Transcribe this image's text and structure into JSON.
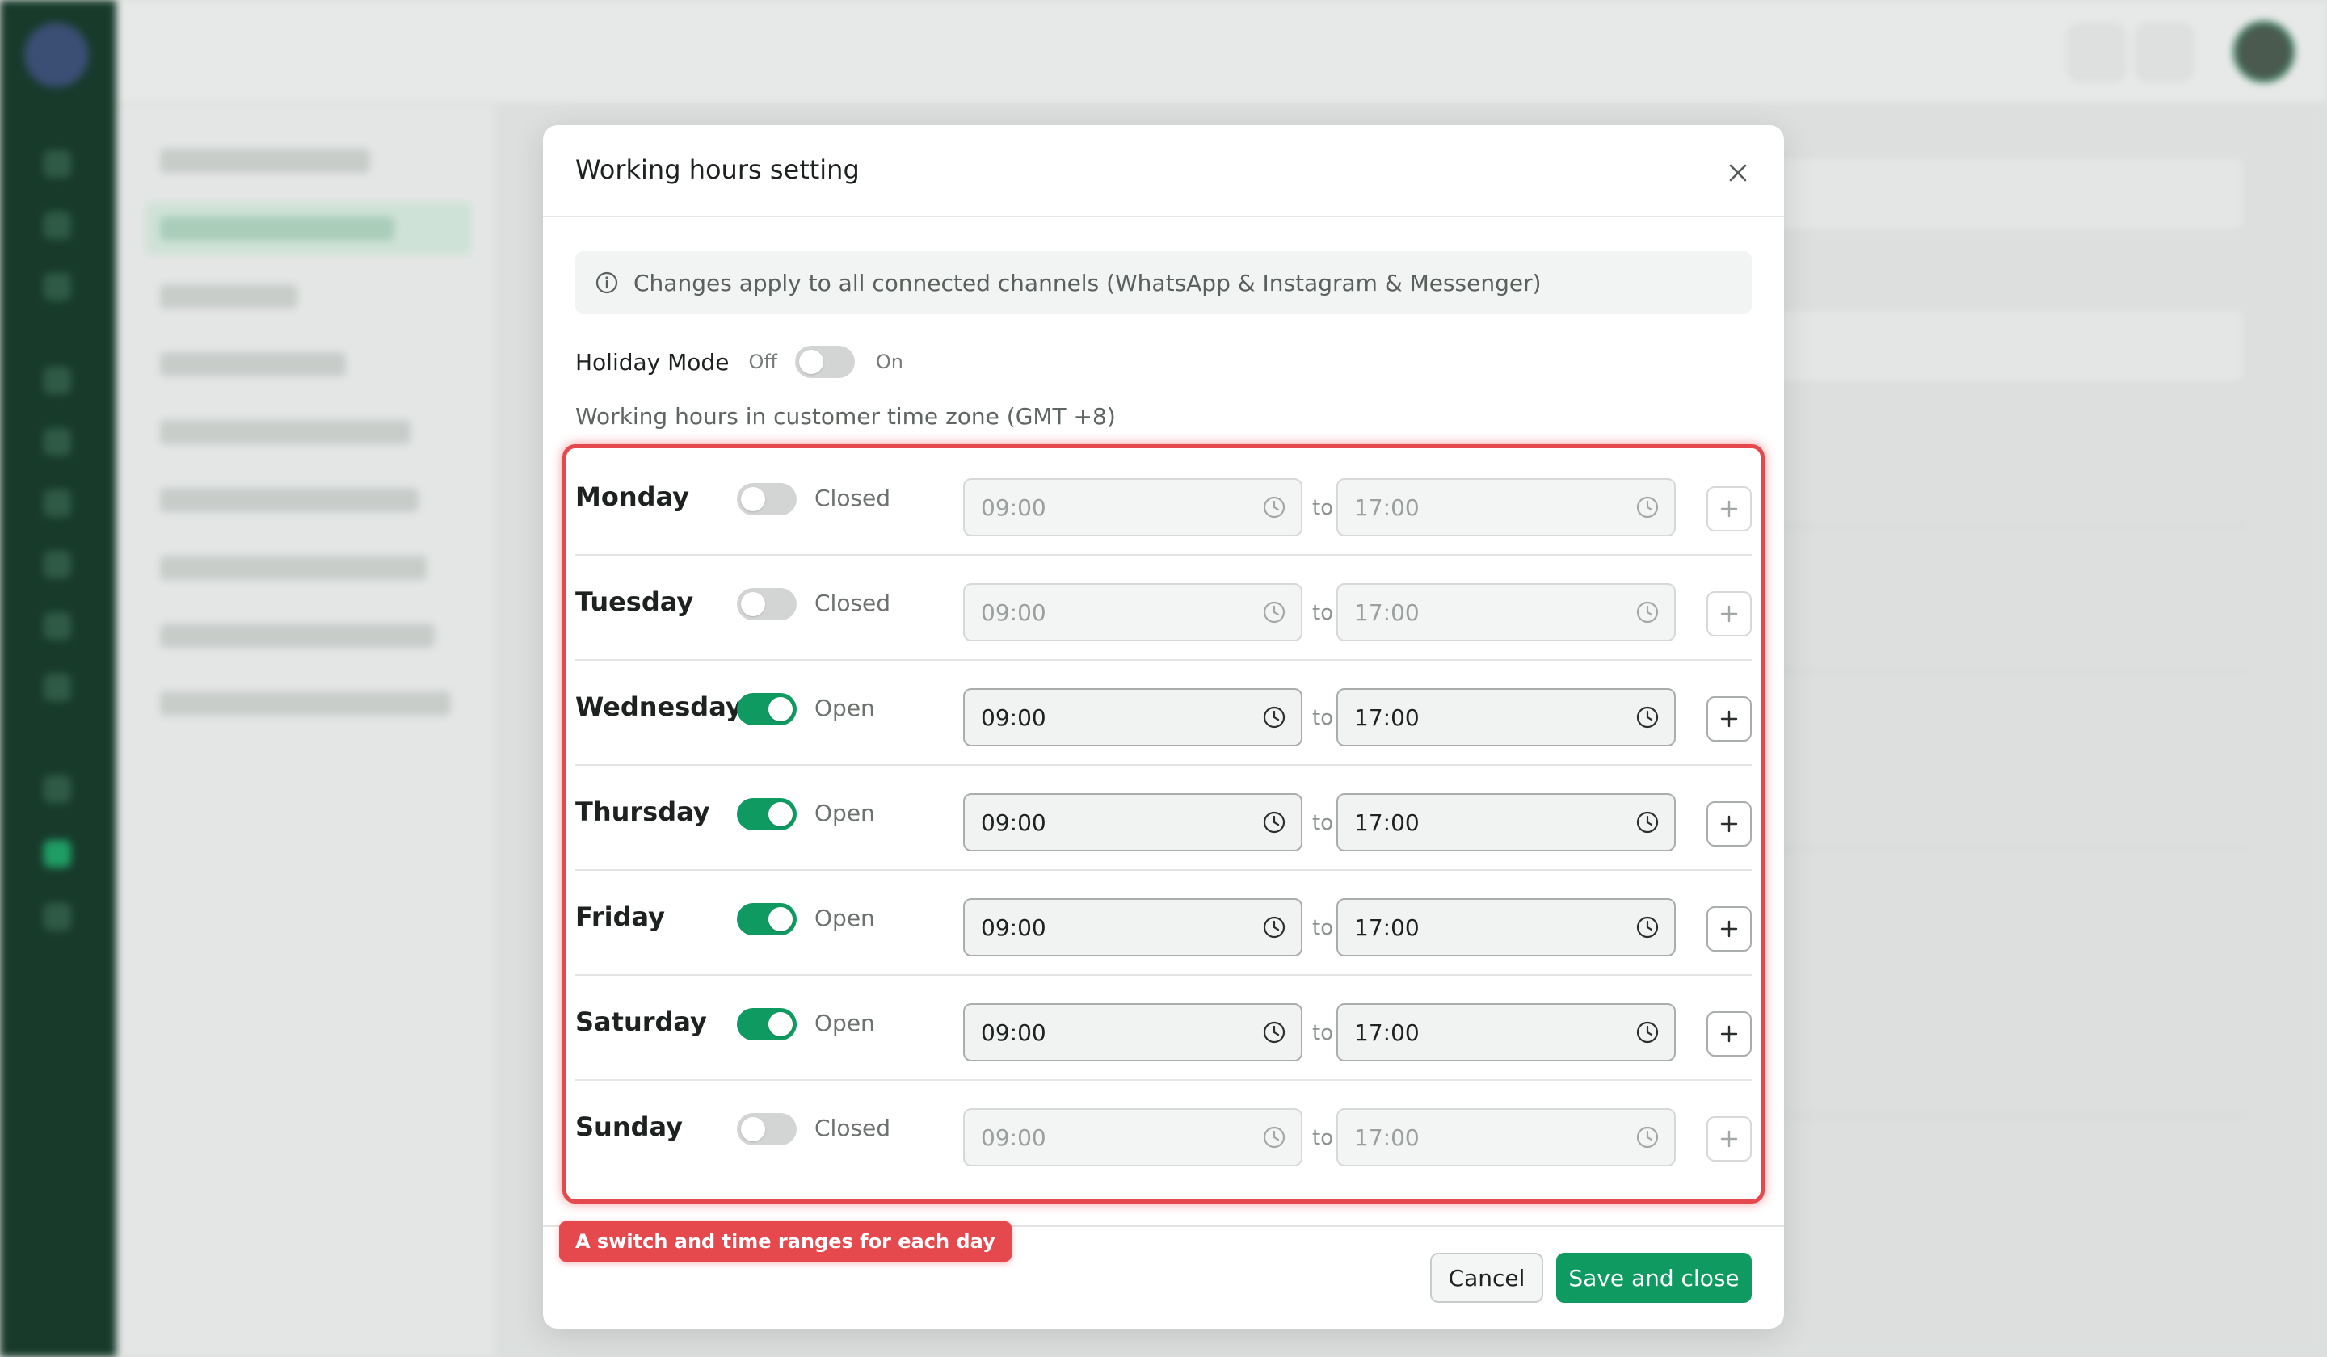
{
  "modal": {
    "title": "Working hours setting",
    "info": "Changes apply to all connected channels (WhatsApp & Instagram & Messenger)",
    "holiday": {
      "label": "Holiday Mode",
      "off_label": "Off",
      "on_label": "On",
      "enabled": false
    },
    "timezone_note": "Working hours in customer time zone (GMT +8)",
    "to_label": "to",
    "days": [
      {
        "name": "Monday",
        "status": "Closed",
        "open": false,
        "start": "09:00",
        "end": "17:00"
      },
      {
        "name": "Tuesday",
        "status": "Closed",
        "open": false,
        "start": "09:00",
        "end": "17:00"
      },
      {
        "name": "Wednesday",
        "status": "Open",
        "open": true,
        "start": "09:00",
        "end": "17:00"
      },
      {
        "name": "Thursday",
        "status": "Open",
        "open": true,
        "start": "09:00",
        "end": "17:00"
      },
      {
        "name": "Friday",
        "status": "Open",
        "open": true,
        "start": "09:00",
        "end": "17:00"
      },
      {
        "name": "Saturday",
        "status": "Open",
        "open": true,
        "start": "09:00",
        "end": "17:00"
      },
      {
        "name": "Sunday",
        "status": "Closed",
        "open": false,
        "start": "09:00",
        "end": "17:00"
      }
    ],
    "cancel_label": "Cancel",
    "save_label": "Save and close"
  },
  "annotation": {
    "text": "A switch and time ranges for each day"
  },
  "colors": {
    "accent": "#0f9a61",
    "annotation": "#e5484d",
    "sidebar": "#173a2b"
  }
}
